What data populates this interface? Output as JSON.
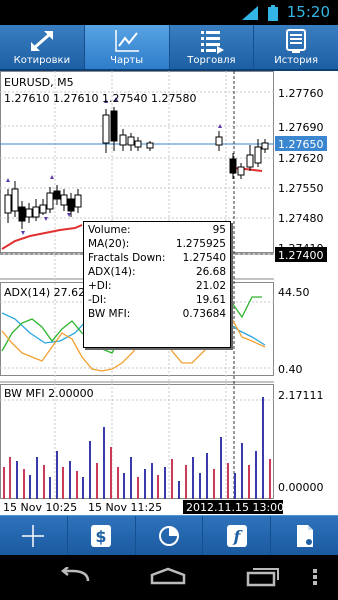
{
  "status_bar": {
    "time": "15:20"
  },
  "tabs": [
    {
      "label": "Котировки",
      "icon": "arrows-expand-icon"
    },
    {
      "label": "Чарты",
      "icon": "chart-line-icon",
      "active": true
    },
    {
      "label": "Торговля",
      "icon": "trade-list-icon"
    },
    {
      "label": "История",
      "icon": "history-monitor-icon"
    }
  ],
  "chart": {
    "symbol": "EURUSD, M5",
    "ohlc": "1.27610 1.27610 1.27540 1.27580",
    "price_labels": [
      "1.27760",
      "1.27690",
      "1.27620",
      "1.27550",
      "1.27480",
      "1.27410"
    ],
    "current_price": "1.27650",
    "cursor_price": "1.27400",
    "adx_header": "ADX(14) 27.62 26.58 11.06",
    "adx_labels": [
      "44.50",
      "0.40"
    ],
    "bwmfi_header": "BW MFI 2.00000",
    "bwmfi_labels": [
      "2.17111",
      "0.00000"
    ],
    "time_labels": [
      "15 Nov 10:25",
      "15 Nov 11:25"
    ],
    "cursor_time": "2012.11.15 13:00",
    "colors": {
      "grid": "#c8c8c8",
      "ma": "#e0302f",
      "adx": "#2aa6dd",
      "plus_di": "#2db52d",
      "minus_di": "#f0a030",
      "bw_blue": "#3a3aaa",
      "bw_red": "#cc3a5a",
      "current_line": "#3a86d0"
    }
  },
  "info_box": {
    "rows": [
      {
        "label": "Volume:",
        "value": "95"
      },
      {
        "label": "MA(20):",
        "value": "1.275925"
      },
      {
        "label": "Fractals Down:",
        "value": "1.27540"
      },
      {
        "label": "ADX(14):",
        "value": "26.68"
      },
      {
        "label": "+DI:",
        "value": "21.02"
      },
      {
        "label": "-DI:",
        "value": "19.61"
      },
      {
        "label": "BW MFI:",
        "value": "0.73684"
      }
    ]
  },
  "toolbar": [
    {
      "name": "crosshair-icon"
    },
    {
      "name": "dollar-icon"
    },
    {
      "name": "pie-chart-icon"
    },
    {
      "name": "function-icon"
    },
    {
      "name": "document-icon"
    }
  ]
}
